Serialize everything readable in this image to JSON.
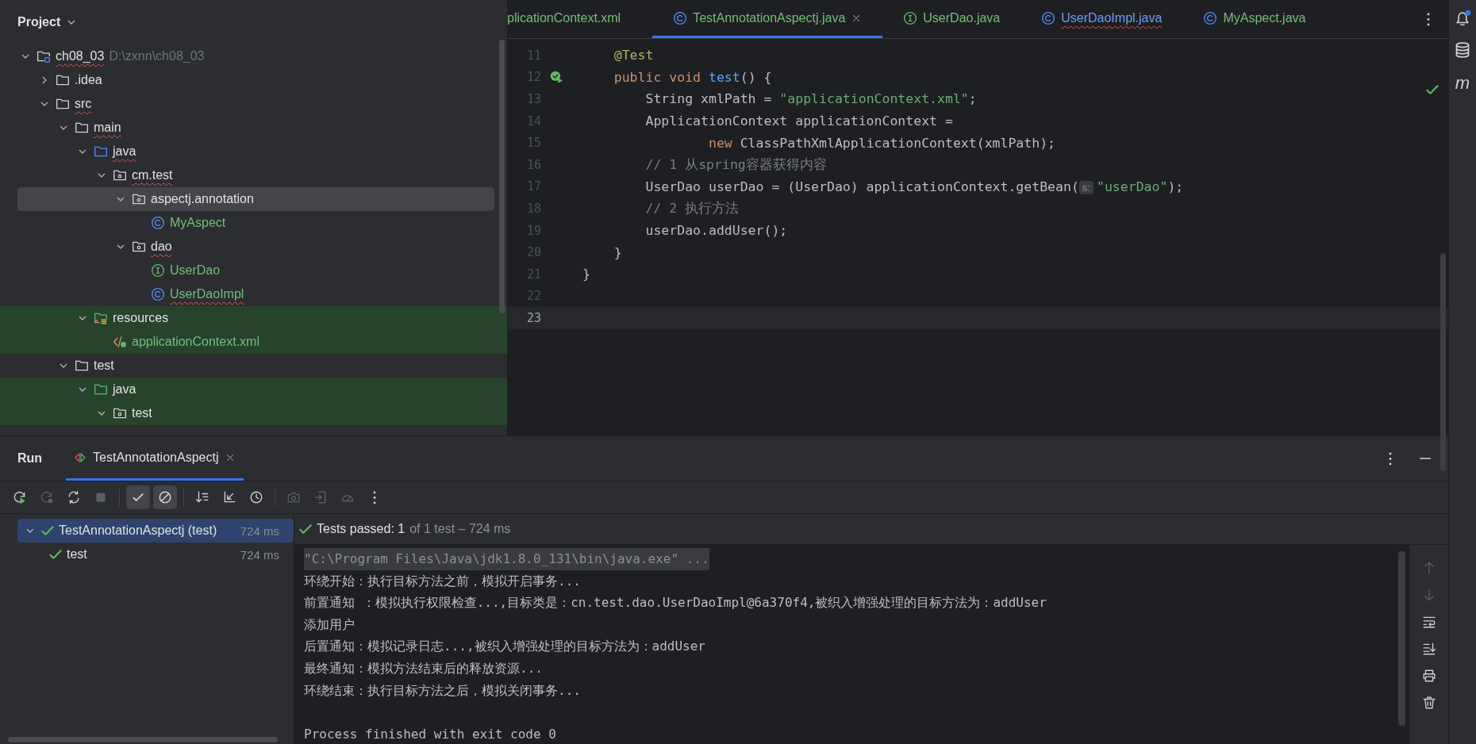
{
  "project_panel": {
    "title": "Project",
    "tree": [
      {
        "label": "ch08_03",
        "path": "D:\\zxnn\\ch08_03",
        "kind": "module",
        "expanded": true,
        "selected": false,
        "highlighted": false,
        "added": false,
        "error": true,
        "children": [
          {
            "label": ".idea",
            "kind": "folder",
            "expanded": false,
            "selected": false,
            "highlighted": false,
            "added": false,
            "error": false
          },
          {
            "label": "src",
            "kind": "folder",
            "expanded": true,
            "selected": false,
            "highlighted": false,
            "added": false,
            "error": true,
            "children": [
              {
                "label": "main",
                "kind": "folder",
                "expanded": true,
                "selected": false,
                "highlighted": false,
                "added": false,
                "error": true,
                "children": [
                  {
                    "label": "java",
                    "kind": "source",
                    "expanded": true,
                    "selected": false,
                    "highlighted": false,
                    "added": false,
                    "error": true,
                    "children": [
                      {
                        "label": "cm.test",
                        "kind": "package",
                        "expanded": true,
                        "selected": false,
                        "highlighted": false,
                        "added": false,
                        "error": true,
                        "children": [
                          {
                            "label": "aspectj.annotation",
                            "kind": "package",
                            "expanded": true,
                            "selected": true,
                            "highlighted": false,
                            "added": false,
                            "error": false,
                            "children": [
                              {
                                "label": "MyAspect",
                                "kind": "class",
                                "selected": false,
                                "highlighted": false,
                                "added": true,
                                "error": false
                              }
                            ]
                          },
                          {
                            "label": "dao",
                            "kind": "package",
                            "expanded": true,
                            "selected": false,
                            "highlighted": false,
                            "added": false,
                            "error": true,
                            "children": [
                              {
                                "label": "UserDao",
                                "kind": "interface",
                                "selected": false,
                                "highlighted": false,
                                "added": true,
                                "error": false
                              },
                              {
                                "label": "UserDaoImpl",
                                "kind": "class",
                                "selected": false,
                                "highlighted": false,
                                "added": true,
                                "error": true
                              }
                            ]
                          }
                        ]
                      }
                    ]
                  },
                  {
                    "label": "resources",
                    "kind": "resources",
                    "expanded": true,
                    "selected": false,
                    "highlighted": true,
                    "added": false,
                    "error": false,
                    "children": [
                      {
                        "label": "applicationContext.xml",
                        "kind": "xml",
                        "selected": false,
                        "highlighted": true,
                        "added": true,
                        "error": false
                      }
                    ]
                  }
                ]
              },
              {
                "label": "test",
                "kind": "folder",
                "expanded": true,
                "selected": false,
                "highlighted": false,
                "added": false,
                "error": false,
                "children": [
                  {
                    "label": "java",
                    "kind": "test-source",
                    "expanded": true,
                    "selected": false,
                    "highlighted": true,
                    "added": false,
                    "error": false,
                    "children": [
                      {
                        "label": "test",
                        "kind": "package",
                        "expanded": true,
                        "selected": false,
                        "highlighted": true,
                        "added": false,
                        "error": false
                      }
                    ]
                  }
                ]
              }
            ]
          }
        ]
      }
    ]
  },
  "editor": {
    "tabs": [
      {
        "label": "plicationContext.xml",
        "modified": false,
        "selected": false,
        "error": false
      },
      {
        "label": "TestAnnotationAspectj.java",
        "kind": "class",
        "modified": false,
        "selected": true,
        "error": false
      },
      {
        "label": "UserDao.java",
        "kind": "interface",
        "modified": false,
        "selected": false,
        "error": false
      },
      {
        "label": "UserDaoImpl.java",
        "kind": "class",
        "modified": true,
        "selected": false,
        "error": true
      },
      {
        "label": "MyAspect.java",
        "kind": "class",
        "modified": false,
        "selected": false,
        "error": false
      }
    ],
    "lines": [
      {
        "number": "11",
        "current": false,
        "run_marker": false,
        "segments": [
          {
            "kind": "annotation",
            "text": "    @Test"
          }
        ]
      },
      {
        "number": "12",
        "current": false,
        "run_marker": true,
        "segments": [
          {
            "kind": "keyword",
            "text": "    public void "
          },
          {
            "kind": "method",
            "text": "test"
          },
          {
            "kind": "plain",
            "text": "() {"
          }
        ]
      },
      {
        "number": "13",
        "current": false,
        "run_marker": false,
        "segments": [
          {
            "kind": "plain",
            "text": "        String xmlPath = "
          },
          {
            "kind": "string",
            "text": "\"applicationContext.xml\""
          },
          {
            "kind": "plain",
            "text": ";"
          }
        ]
      },
      {
        "number": "14",
        "current": false,
        "run_marker": false,
        "segments": [
          {
            "kind": "plain",
            "text": "        ApplicationContext applicationContext ="
          }
        ]
      },
      {
        "number": "15",
        "current": false,
        "run_marker": false,
        "segments": [
          {
            "kind": "keyword",
            "text": "                new "
          },
          {
            "kind": "plain",
            "text": "ClassPathXmlApplicationContext(xmlPath);"
          }
        ]
      },
      {
        "number": "16",
        "current": false,
        "run_marker": false,
        "segments": [
          {
            "kind": "comment",
            "text": "        // 1 从spring容器获得内容"
          }
        ]
      },
      {
        "number": "17",
        "current": false,
        "run_marker": false,
        "segments": [
          {
            "kind": "plain",
            "text": "        UserDao userDao = (UserDao) applicationContext.getBean("
          },
          {
            "kind": "hint",
            "text": "s:"
          },
          {
            "kind": "string",
            "text": "\"userDao\""
          },
          {
            "kind": "plain",
            "text": ");"
          }
        ]
      },
      {
        "number": "18",
        "current": false,
        "run_marker": false,
        "segments": [
          {
            "kind": "comment",
            "text": "        // 2 执行方法"
          }
        ]
      },
      {
        "number": "19",
        "current": false,
        "run_marker": false,
        "segments": [
          {
            "kind": "plain",
            "text": "        userDao.addUser();"
          }
        ]
      },
      {
        "number": "20",
        "current": false,
        "run_marker": false,
        "segments": [
          {
            "kind": "plain",
            "text": "    }"
          }
        ]
      },
      {
        "number": "21",
        "current": false,
        "run_marker": false,
        "segments": [
          {
            "kind": "plain",
            "text": "}"
          }
        ]
      },
      {
        "number": "22",
        "current": false,
        "run_marker": false
      },
      {
        "number": "23",
        "current": true,
        "run_marker": false
      }
    ]
  },
  "run_panel": {
    "title": "Run",
    "tabs": [
      {
        "label": "TestAnnotationAspectj",
        "selected": true
      }
    ],
    "toolbar": [
      {
        "kind": "rerun",
        "toggled": false,
        "disabled": false,
        "separator_before": false
      },
      {
        "kind": "rerun-failed",
        "toggled": false,
        "disabled": true,
        "separator_before": false
      },
      {
        "kind": "toggle-auto",
        "toggled": false,
        "disabled": false,
        "separator_before": false
      },
      {
        "kind": "stop",
        "toggled": false,
        "disabled": true,
        "separator_before": false
      },
      {
        "kind": "show-passed",
        "toggled": true,
        "disabled": false,
        "separator_before": true
      },
      {
        "kind": "show-ignored",
        "toggled": true,
        "disabled": false,
        "separator_before": false
      },
      {
        "kind": "sort",
        "toggled": false,
        "disabled": false,
        "separator_before": true
      },
      {
        "kind": "collapse",
        "toggled": false,
        "disabled": false,
        "separator_before": false
      },
      {
        "kind": "history",
        "toggled": false,
        "disabled": false,
        "separator_before": false
      },
      {
        "kind": "snapshot",
        "toggled": false,
        "disabled": true,
        "separator_before": true
      },
      {
        "kind": "import",
        "toggled": false,
        "disabled": true,
        "separator_before": false
      },
      {
        "kind": "gauge",
        "toggled": false,
        "disabled": true,
        "separator_before": false
      },
      {
        "kind": "more",
        "toggled": false,
        "disabled": false,
        "separator_before": false
      }
    ],
    "test_tree": [
      {
        "label": "TestAnnotationAspectj (test)",
        "duration": "724 ms",
        "passed": true,
        "selected": true,
        "expanded": true,
        "children": [
          {
            "label": "test",
            "duration": "724 ms",
            "passed": true,
            "selected": false
          }
        ]
      }
    ],
    "summary": {
      "status": "Tests passed: 1",
      "detail": "of 1 test – 724 ms"
    },
    "console": [
      {
        "kind": "command",
        "text": "\"C:\\Program Files\\Java\\jdk1.8.0_131\\bin\\java.exe\" ..."
      },
      {
        "kind": "output",
        "text": "环绕开始：执行目标方法之前，模拟开启事务..."
      },
      {
        "kind": "output",
        "text": "前置通知 ：模拟执行权限检查...,目标类是：cn.test.dao.UserDaoImpl@6a370f4,被织入增强处理的目标方法为：addUser"
      },
      {
        "kind": "output",
        "text": "添加用户"
      },
      {
        "kind": "output",
        "text": "后置通知：模拟记录日志...,被织入增强处理的目标方法为：addUser"
      },
      {
        "kind": "output",
        "text": "最终通知：模拟方法结束后的释放资源..."
      },
      {
        "kind": "output",
        "text": "环绕结束：执行目标方法之后，模拟关闭事务..."
      },
      {
        "kind": "blank"
      },
      {
        "kind": "output",
        "text": "Process finished with exit code 0"
      }
    ],
    "console_tools": [
      {
        "kind": "up",
        "disabled": true
      },
      {
        "kind": "down",
        "disabled": true
      },
      {
        "kind": "wrap",
        "disabled": false
      },
      {
        "kind": "scroll-end",
        "disabled": false
      },
      {
        "kind": "print",
        "disabled": false
      },
      {
        "kind": "trash",
        "disabled": false
      }
    ]
  },
  "right_stripe": [
    {
      "kind": "bell",
      "badge": true
    },
    {
      "kind": "database"
    },
    {
      "kind": "maven",
      "glyph": "m"
    }
  ]
}
